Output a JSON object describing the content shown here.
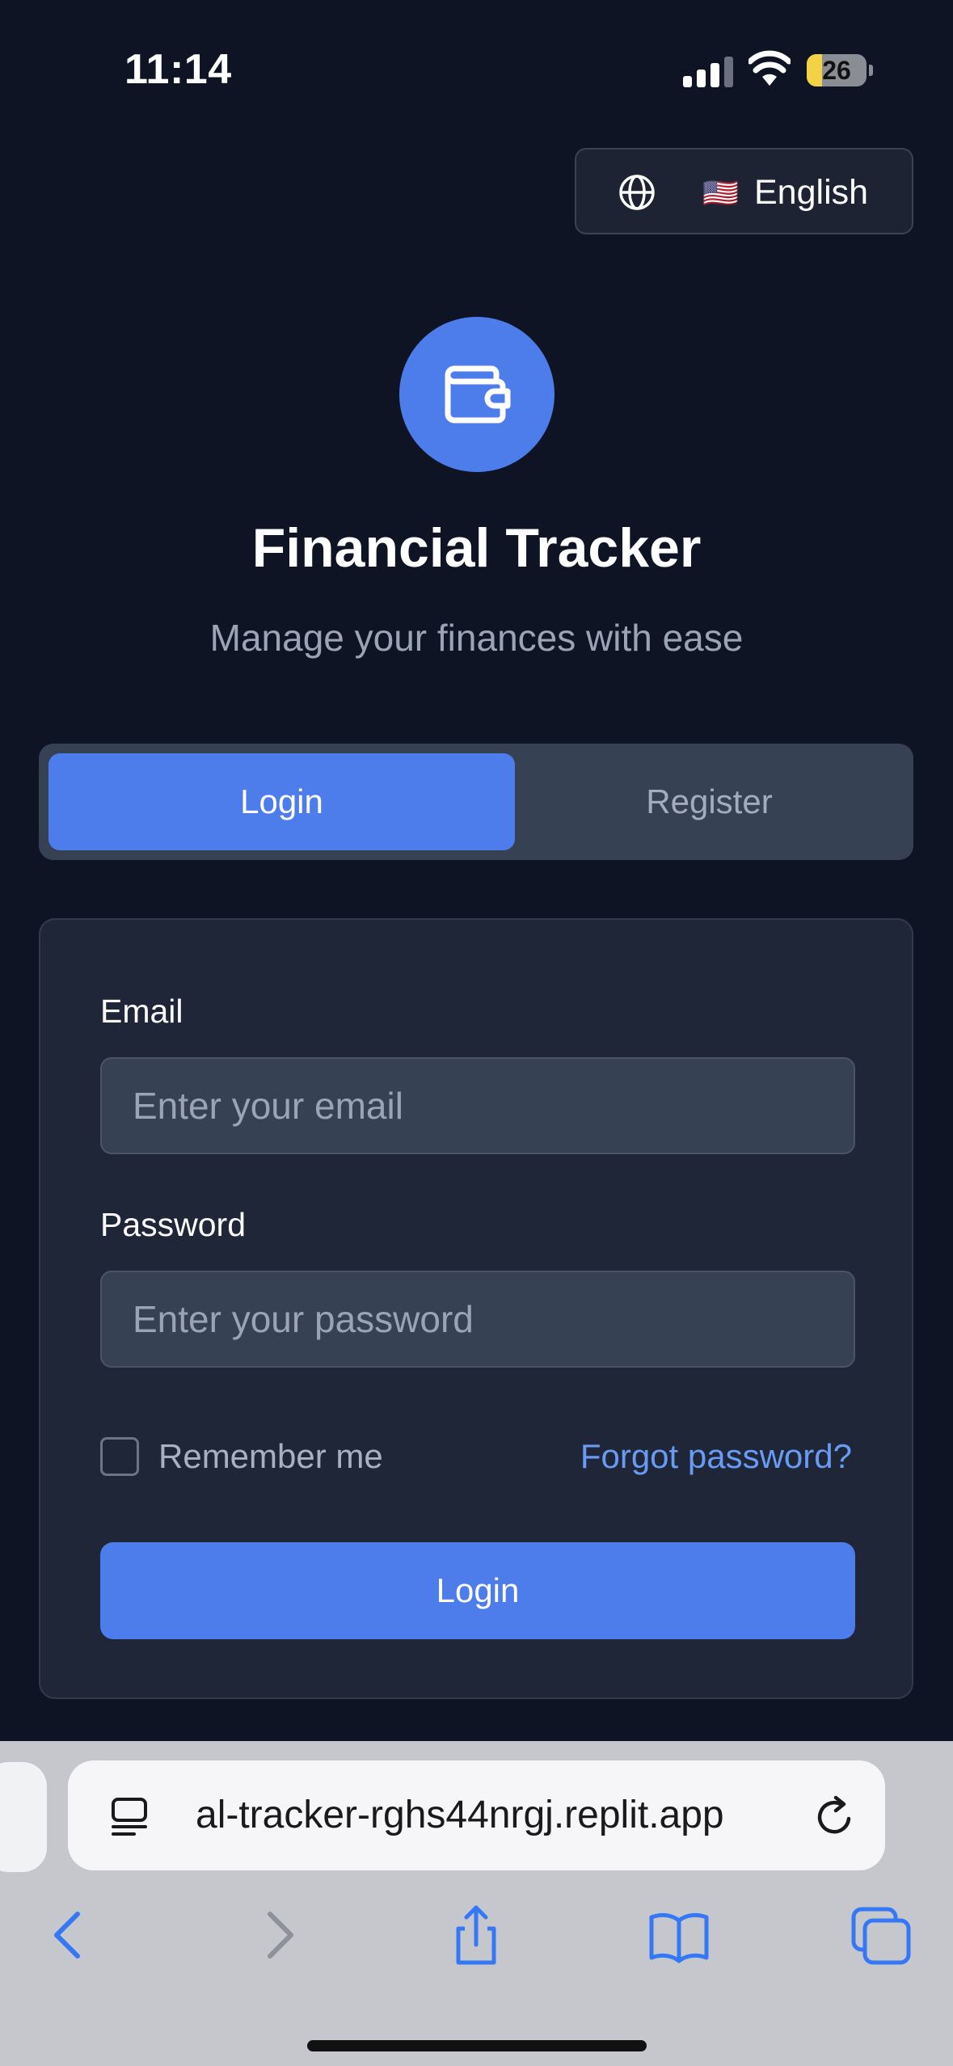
{
  "status_bar": {
    "time": "11:14",
    "battery_level": "26"
  },
  "language_selector": {
    "flag": "🇺🇸",
    "label": "English",
    "icon": "globe-icon"
  },
  "header": {
    "logo_icon": "wallet-icon",
    "title": "Financial Tracker",
    "subtitle": "Manage your finances with ease"
  },
  "tabs": [
    {
      "label": "Login",
      "active": true
    },
    {
      "label": "Register",
      "active": false
    }
  ],
  "form": {
    "email_label": "Email",
    "email_placeholder": "Enter your email",
    "email_value": "",
    "password_label": "Password",
    "password_placeholder": "Enter your password",
    "password_value": "",
    "remember_label": "Remember me",
    "remember_checked": false,
    "forgot_label": "Forgot password?",
    "submit_label": "Login"
  },
  "browser": {
    "url": "al-tracker-rghs44nrgj.replit.app",
    "page_icon": "page-menu-icon",
    "reload_icon": "reload-icon",
    "nav_icons": [
      "back-icon",
      "forward-icon",
      "share-icon",
      "bookmarks-icon",
      "tabs-icon"
    ]
  },
  "colors": {
    "background": "#0f1425",
    "accent": "#4d7deb",
    "card": "#1f2638",
    "link": "#6a9bf4",
    "browser_accent": "#3478f6"
  }
}
